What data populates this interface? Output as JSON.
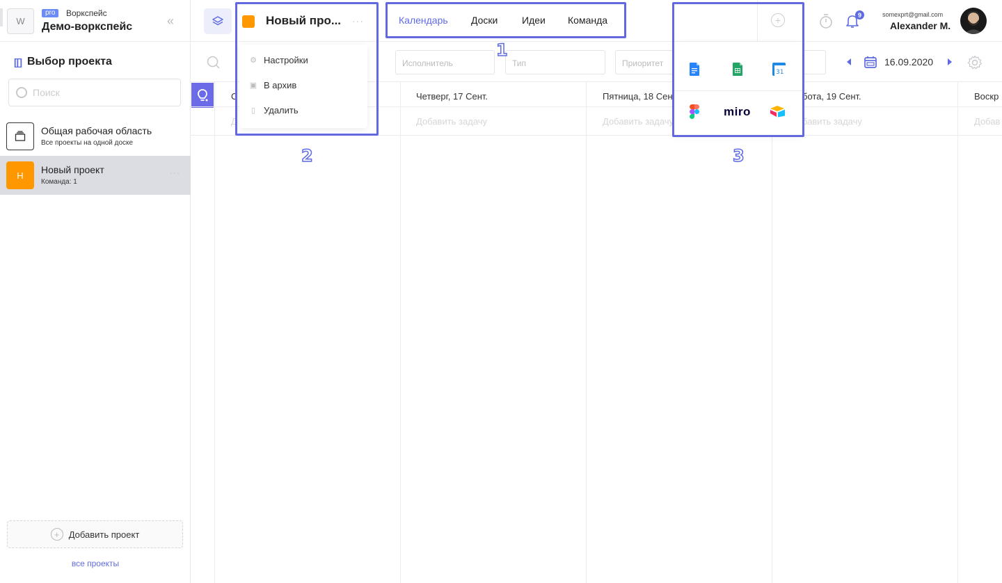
{
  "workspace": {
    "avatar_letter": "W",
    "badge": "pro",
    "kind": "Воркспейс",
    "name": "Демо-воркспейс"
  },
  "sidebar": {
    "title": "Выбор проекта",
    "search_placeholder": "Поиск",
    "items": [
      {
        "title": "Общая рабочая область",
        "subtitle": "Все проекты на одной доске"
      },
      {
        "letter": "Н",
        "title": "Новый проект",
        "subtitle": "Команда: 1",
        "color": "#ff9800"
      }
    ],
    "add_label": "Добавить проект",
    "all_label": "все проекты"
  },
  "header": {
    "project_name": "Новый про...",
    "project_color": "#ff9800",
    "tabs": [
      {
        "label": "Календарь"
      },
      {
        "label": "Доски"
      },
      {
        "label": "Идеи"
      },
      {
        "label": "Команда"
      }
    ],
    "notifications": "9",
    "email": "somexprt@gmail.com",
    "user": "Alexander M."
  },
  "project_menu": {
    "items": [
      {
        "label": "Настройки"
      },
      {
        "label": "В архив"
      },
      {
        "label": "Удалить"
      }
    ]
  },
  "filters": {
    "assignee": "Исполнитель",
    "type": "Тип",
    "priority": "Приоритет",
    "date": "16.09.2020"
  },
  "calendar": {
    "days": [
      {
        "label": "С"
      },
      {
        "label": "Четверг, 17 Сент."
      },
      {
        "label": "Пятница, 18 Сен"
      },
      {
        "label": "бота, 19 Сент."
      },
      {
        "label": "Воскр"
      }
    ],
    "add_tasks": [
      "Д",
      "Добавить задачу",
      "Добавить задачу",
      "бавить задачу",
      "Добав"
    ]
  },
  "integrations": {
    "miro_label": "miro"
  },
  "annotations": [
    "1",
    "2",
    "3"
  ],
  "accent": "#5f6be0"
}
